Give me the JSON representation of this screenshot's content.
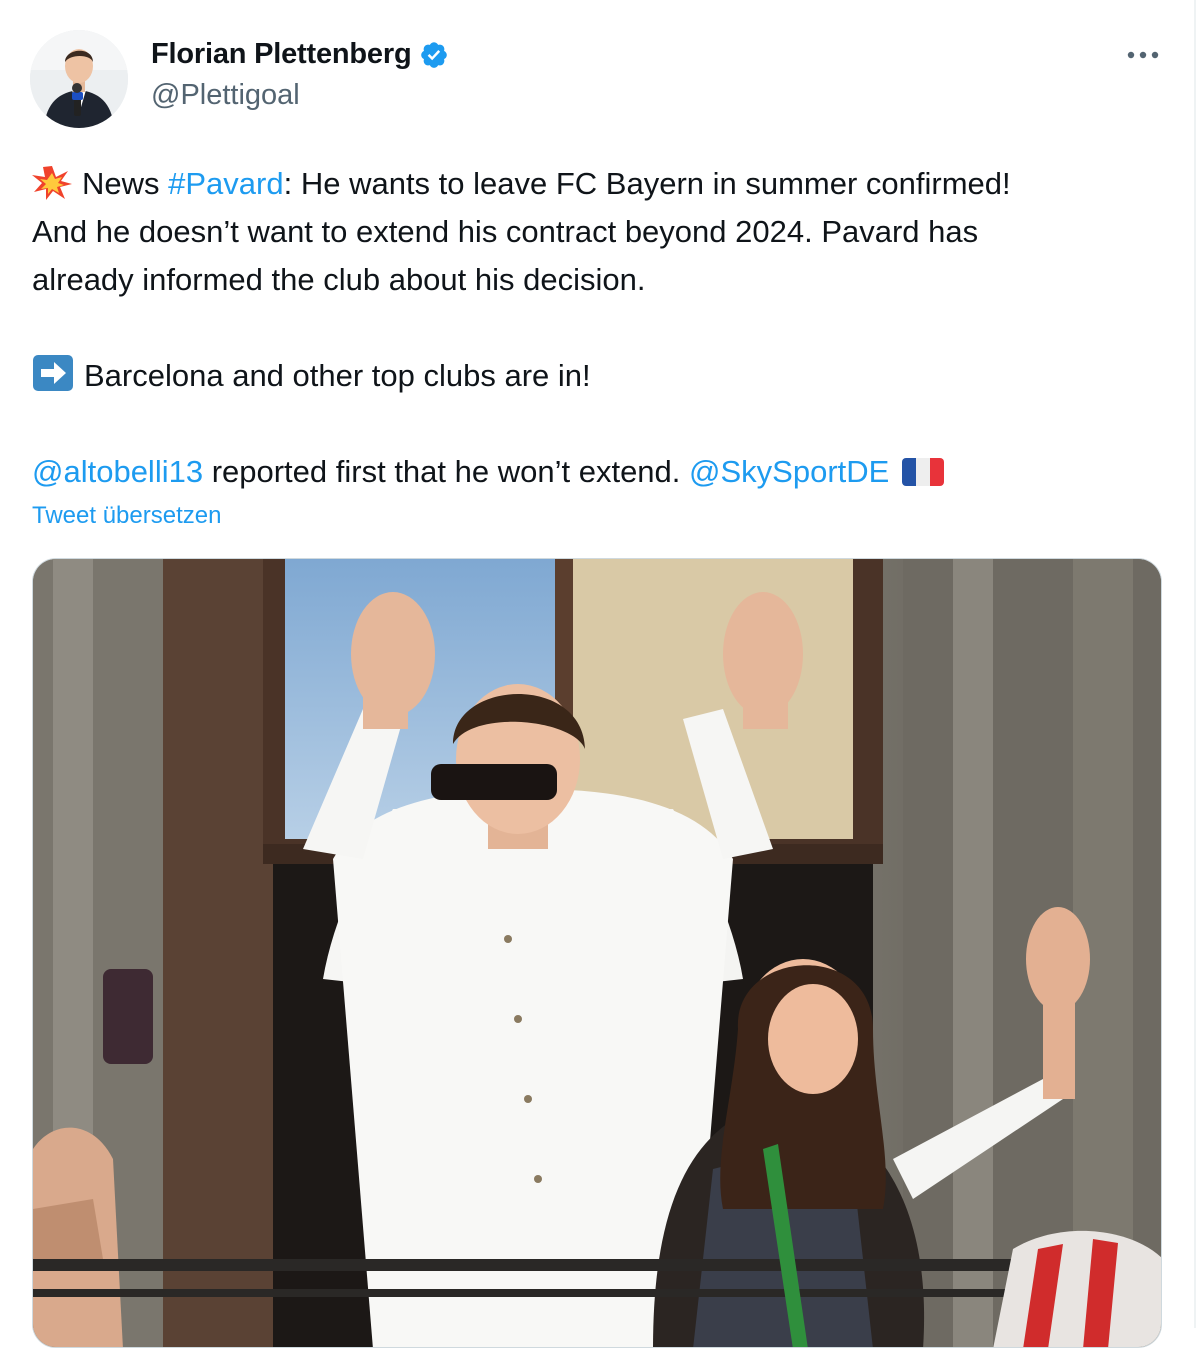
{
  "author": {
    "display_name": "Florian Plettenberg",
    "handle": "@Plettigoal",
    "verified": true,
    "avatar_icon": "avatar-photo"
  },
  "more_icon": "more-horizontal-icon",
  "tweet": {
    "line1": {
      "emoji": "collision-emoji",
      "word": "News",
      "hashtag": "#Pavard",
      "rest": ": He wants to leave FC Bayern in summer confirmed!"
    },
    "line2": "And he doesn’t want to extend his contract beyond 2024. Pavard has",
    "line3": "already informed the club about his decision.",
    "line4": {
      "emoji": "right-arrow-emoji",
      "text": "Barcelona and other top clubs are in!"
    },
    "line5": {
      "mention1": "@altobelli13",
      "middle": " reported first that he won’t extend. ",
      "mention2": "@SkySportDE",
      "flag": "flag-france-emoji"
    }
  },
  "translate_label": "Tweet übersetzen",
  "media": {
    "type": "photo",
    "description_icon": "tweet-photo"
  },
  "colors": {
    "link": "#1d9bf0",
    "text": "#0f1419",
    "secondary": "#536471",
    "border": "#cfd9de"
  }
}
